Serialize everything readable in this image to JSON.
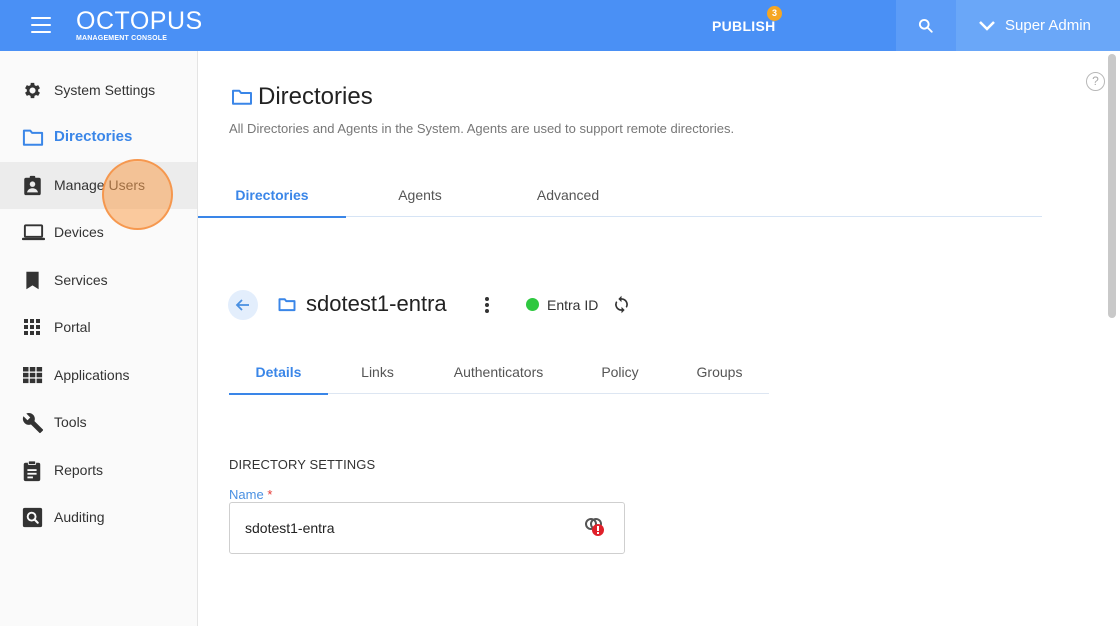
{
  "header": {
    "brand_name": "OCTOPUS",
    "brand_subtitle": "MANAGEMENT CONSOLE",
    "publish_label": "PUBLISH",
    "publish_badge": "3",
    "user_name": "Super Admin"
  },
  "colors": {
    "header_bg": "#4a90f5",
    "accent": "#3a86e8",
    "status_active": "#2ec840",
    "badge": "#f5a623"
  },
  "sidebar": {
    "items": [
      {
        "label": "System Settings",
        "icon": "gear-icon"
      },
      {
        "label": "Directories",
        "icon": "folder-icon",
        "active": true
      },
      {
        "label": "Manage Users",
        "icon": "user-badge-icon"
      },
      {
        "label": "Devices",
        "icon": "laptop-icon"
      },
      {
        "label": "Services",
        "icon": "bookmark-icon"
      },
      {
        "label": "Portal",
        "icon": "grid-icon"
      },
      {
        "label": "Applications",
        "icon": "apps-icon"
      },
      {
        "label": "Tools",
        "icon": "wrench-icon"
      },
      {
        "label": "Reports",
        "icon": "clipboard-icon"
      },
      {
        "label": "Auditing",
        "icon": "search-report-icon"
      }
    ]
  },
  "page": {
    "title": "Directories",
    "subtitle": "All Directories and Agents in the System. Agents are used to support remote directories.",
    "tabs": [
      {
        "label": "Directories",
        "active": true
      },
      {
        "label": "Agents"
      },
      {
        "label": "Advanced"
      }
    ]
  },
  "directory": {
    "name": "sdotest1-entra",
    "status_label": "Entra ID",
    "tabs": [
      {
        "label": "Details",
        "active": true
      },
      {
        "label": "Links"
      },
      {
        "label": "Authenticators"
      },
      {
        "label": "Policy"
      },
      {
        "label": "Groups"
      }
    ]
  },
  "details": {
    "section_title": "DIRECTORY SETTINGS",
    "name_label": "Name",
    "name_required": "*",
    "name_value": "sdotest1-entra"
  }
}
